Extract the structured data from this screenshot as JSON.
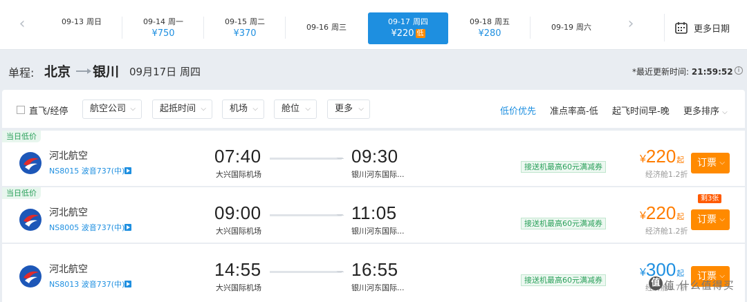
{
  "dates": [
    {
      "date": "09-13",
      "weekday": "周日",
      "price": ""
    },
    {
      "date": "09-14",
      "weekday": "周一",
      "price": "¥750"
    },
    {
      "date": "09-15",
      "weekday": "周二",
      "price": "¥370"
    },
    {
      "date": "09-16",
      "weekday": "周三",
      "price": ""
    },
    {
      "date": "09-17",
      "weekday": "周四",
      "price": "¥220",
      "badge": "低",
      "selected": true
    },
    {
      "date": "09-18",
      "weekday": "周五",
      "price": "¥280"
    },
    {
      "date": "09-19",
      "weekday": "周六",
      "price": ""
    }
  ],
  "more_dates_label": "更多日期",
  "route": {
    "lead": "单程:",
    "from": "北京",
    "to": "银川",
    "date": "09月17日 周四",
    "updated_label": "*最近更新时间:",
    "updated_time": "21:59:52"
  },
  "filters": {
    "direct_label": "直飞/经停",
    "dropdowns": [
      "航空公司",
      "起抵时间",
      "机场",
      "舱位",
      "更多"
    ],
    "sorts": [
      "低价优先",
      "准点率高-低",
      "起飞时间早-晚",
      "更多排序"
    ]
  },
  "flights": [
    {
      "tag": "当日低价",
      "airline": "河北航空",
      "flight_no": "NS8015 波音737(中)",
      "dep_time": "07:40",
      "dep_airport": "大兴国际机场",
      "arr_time": "09:30",
      "arr_airport": "银川河东国际...",
      "coupon": "接送机最高60元满减券",
      "currency": "¥",
      "price": "220",
      "price_suffix": "起",
      "cabin": "经济舱1.2折",
      "book_label": "订票",
      "seats_left": ""
    },
    {
      "tag": "当日低价",
      "airline": "河北航空",
      "flight_no": "NS8005 波音737(中)",
      "dep_time": "09:00",
      "dep_airport": "大兴国际机场",
      "arr_time": "11:05",
      "arr_airport": "银川河东国际...",
      "coupon": "接送机最高60元满减券",
      "currency": "¥",
      "price": "220",
      "price_suffix": "起",
      "cabin": "经济舱1.2折",
      "book_label": "订票",
      "seats_left": "剩3张"
    },
    {
      "tag": "",
      "airline": "河北航空",
      "flight_no": "NS8013 波音737(中)",
      "dep_time": "14:55",
      "dep_airport": "大兴国际机场",
      "arr_time": "16:55",
      "arr_airport": "银川河东国际...",
      "coupon": "接送机最高60元满减券",
      "currency": "¥",
      "price": "300",
      "price_suffix": "起",
      "cabin": "经济舱1.7折",
      "book_label": "订票",
      "seats_left": ""
    }
  ],
  "watermark": "值 什么值得买",
  "colors": {
    "accent": "#1e8fe0",
    "orange": "#ff8a00",
    "green": "#2aa05a"
  }
}
